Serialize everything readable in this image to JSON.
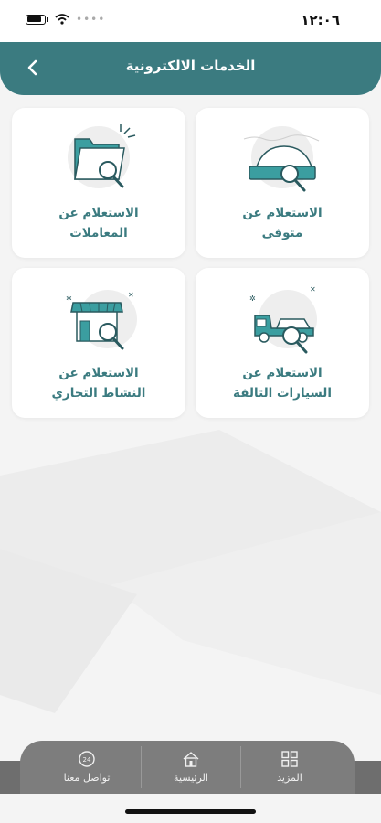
{
  "status": {
    "time": "١٢:٠٦"
  },
  "header": {
    "title": "الخدمات الالكترونية"
  },
  "cards": [
    {
      "label_line1": "الاستعلام عن",
      "label_line2": "متوفى",
      "icon": "deceased-inquiry-icon"
    },
    {
      "label_line1": "الاستعلام عن",
      "label_line2": "المعاملات",
      "icon": "folder-search-icon"
    },
    {
      "label_line1": "الاستعلام عن",
      "label_line2": "السيارات التالفة",
      "icon": "tow-truck-icon"
    },
    {
      "label_line1": "الاستعلام عن",
      "label_line2": "النشاط التجاري",
      "icon": "store-search-icon"
    }
  ],
  "nav": {
    "more": "المزيد",
    "home": "الرئيسية",
    "contact": "تواصل معنا"
  },
  "colors": {
    "accent": "#3b7b80",
    "nav": "#7d7d7d"
  }
}
